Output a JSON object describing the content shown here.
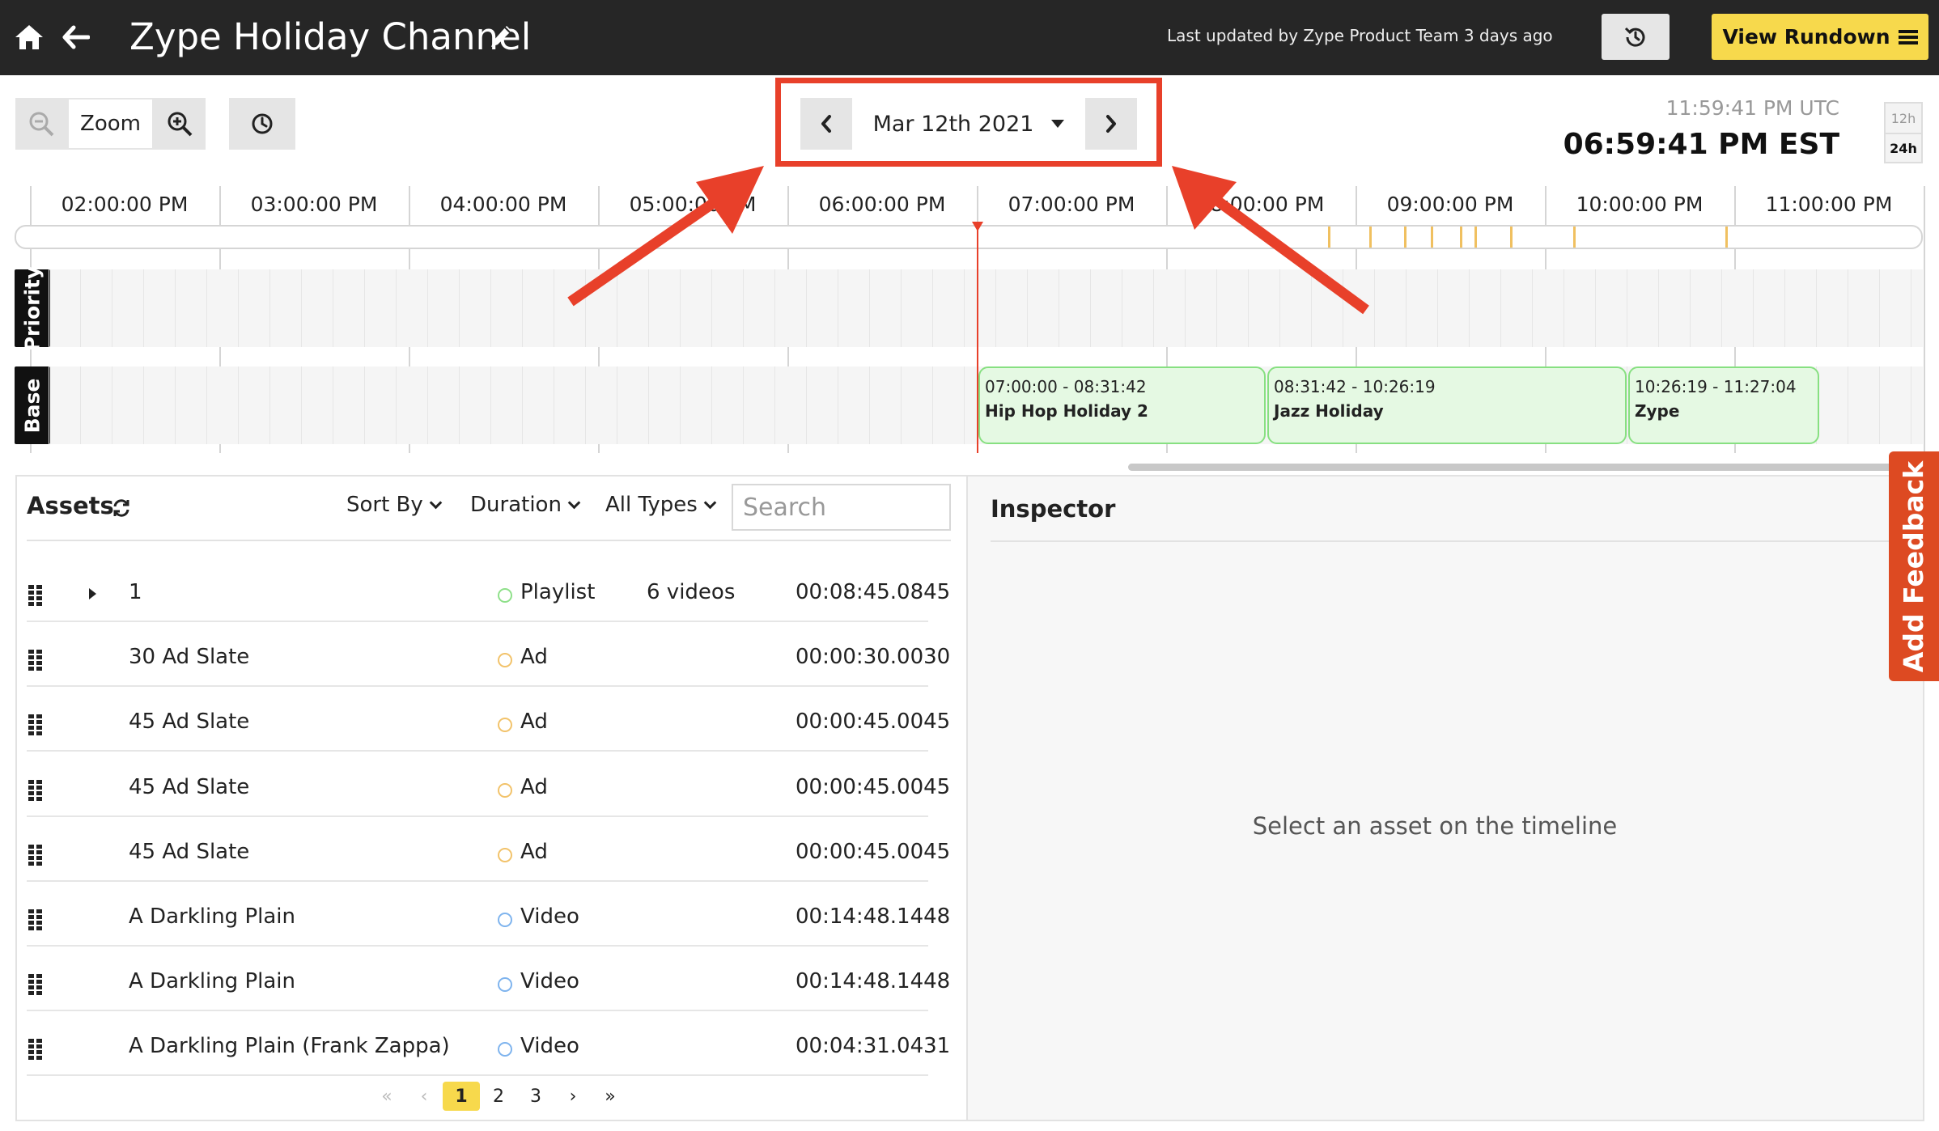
{
  "header": {
    "title": "Zype Holiday Channel",
    "updated": "Last updated by Zype Product Team 3 days ago",
    "rundown_label": "View Rundown"
  },
  "toolbar": {
    "zoom_label": "Zoom",
    "date": "Mar 12th 2021",
    "utc_time": "11:59:41 PM UTC",
    "est_time": "06:59:41 PM EST",
    "mode_12h": "12h",
    "mode_24h": "24h",
    "active_mode": "24h"
  },
  "timeline": {
    "hour_labels": [
      "02:00:00 PM",
      "03:00:00 PM",
      "04:00:00 PM",
      "05:00:00 PM",
      "06:00:00 PM",
      "07:00:00 PM",
      "08:00:00 PM",
      "09:00:00 PM",
      "10:00:00 PM",
      "11:00:00 PM"
    ],
    "lanes": [
      "Priority",
      "Base"
    ],
    "events": [
      {
        "time": "07:00:00 - 08:31:42",
        "name": "Hip Hop Holiday 2"
      },
      {
        "time": "08:31:42 - 10:26:19",
        "name": "Jazz Holiday"
      },
      {
        "time": "10:26:19 - 11:27:04",
        "name": "Zype"
      }
    ]
  },
  "assets": {
    "title": "Assets",
    "sort_label": "Sort By",
    "duration_label": "Duration",
    "types_label": "All Types",
    "search_placeholder": "Search",
    "rows": [
      {
        "name": "1",
        "type": "Playlist",
        "count": "6 videos",
        "duration": "00:08:45.0845",
        "expandable": true
      },
      {
        "name": "30 Ad Slate",
        "type": "Ad",
        "count": "",
        "duration": "00:00:30.0030"
      },
      {
        "name": "45 Ad Slate",
        "type": "Ad",
        "count": "",
        "duration": "00:00:45.0045"
      },
      {
        "name": "45 Ad Slate",
        "type": "Ad",
        "count": "",
        "duration": "00:00:45.0045"
      },
      {
        "name": "45 Ad Slate",
        "type": "Ad",
        "count": "",
        "duration": "00:00:45.0045"
      },
      {
        "name": "A Darkling Plain",
        "type": "Video",
        "count": "",
        "duration": "00:14:48.1448"
      },
      {
        "name": "A Darkling Plain",
        "type": "Video",
        "count": "",
        "duration": "00:14:48.1448"
      },
      {
        "name": "A Darkling Plain (Frank Zappa)",
        "type": "Video",
        "count": "",
        "duration": "00:04:31.0431"
      }
    ],
    "type_colors": {
      "Playlist": "#8fe08a",
      "Ad": "#f2c36b",
      "Video": "#7fb4ee"
    },
    "pagination": {
      "first": "«",
      "prev": "‹",
      "pages": [
        "1",
        "2",
        "3"
      ],
      "current": "1",
      "next": "›",
      "last": "»"
    }
  },
  "inspector": {
    "title": "Inspector",
    "empty_text": "Select an asset on the timeline"
  },
  "feedback_label": "Add Feedback",
  "colors": {
    "accent": "#f7d94c",
    "annotation": "#e8402a",
    "feedback": "#dd4a22"
  }
}
